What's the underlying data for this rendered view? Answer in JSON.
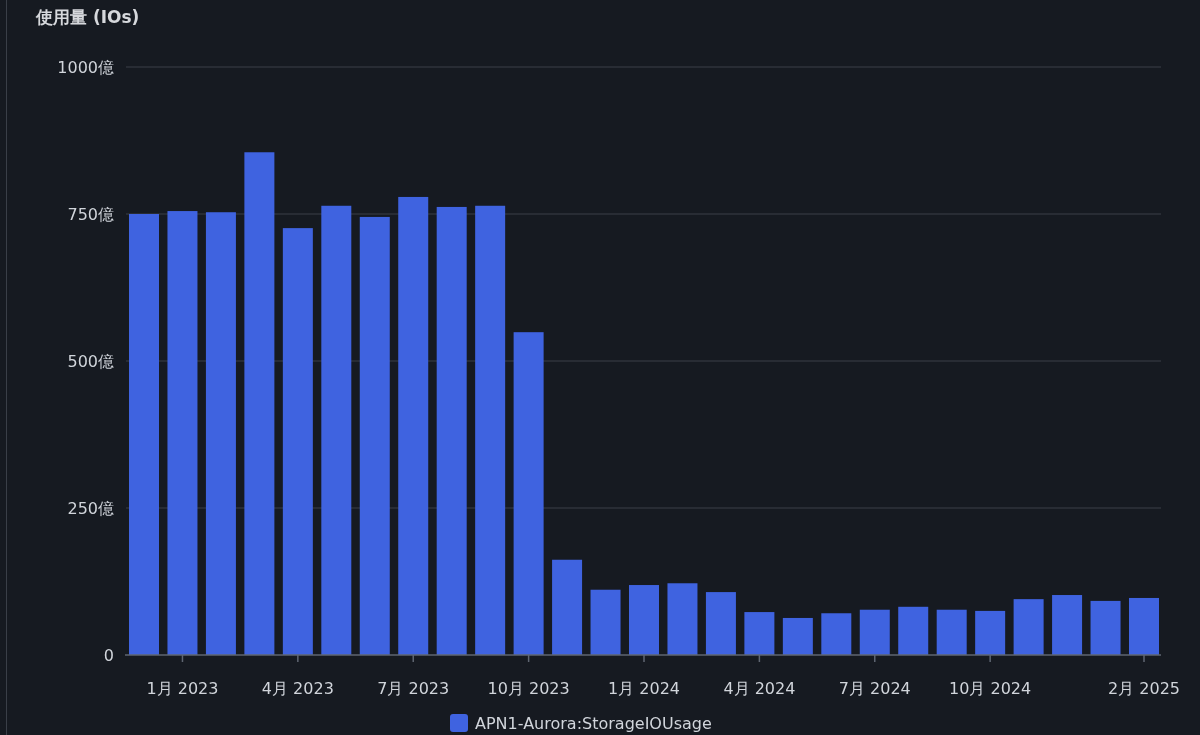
{
  "panel": {
    "chart_data": {
      "type": "bar",
      "ylabel": "使用量 (IOs)",
      "categories": [
        null,
        "1月 2023",
        null,
        null,
        "4月 2023",
        null,
        null,
        "7月 2023",
        null,
        null,
        "10月 2023",
        null,
        null,
        "1月 2024",
        null,
        null,
        "4月 2024",
        null,
        null,
        "7月 2024",
        null,
        null,
        "10月 2024",
        null,
        null,
        null,
        "2月 2025"
      ],
      "series": [
        {
          "name": "APN1-Aurora:StorageIOUsage",
          "color": "#3f63e0",
          "values": [
            750,
            755,
            753,
            855,
            726,
            764,
            745,
            779,
            762,
            764,
            549,
            162,
            111,
            119,
            122,
            107,
            73,
            63,
            71,
            77,
            82,
            77,
            75,
            95,
            102,
            92,
            97
          ]
        }
      ],
      "ylim": [
        0,
        1000
      ],
      "yticks": [
        {
          "value": 0,
          "label": "0"
        },
        {
          "value": 250,
          "label": "250億"
        },
        {
          "value": 500,
          "label": "500億"
        },
        {
          "value": 750,
          "label": "750億"
        },
        {
          "value": 1000,
          "label": "1000億"
        }
      ],
      "grid": true
    }
  }
}
